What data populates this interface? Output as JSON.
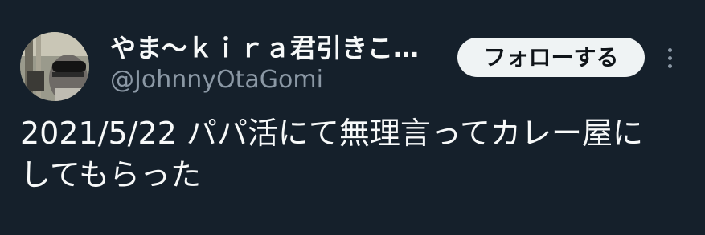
{
  "tweet": {
    "author": {
      "display_name": "やま〜ｋｉｒａ君引きこ…",
      "handle": "@JohnnyOtaGomi"
    },
    "follow_button_label": "フォローする",
    "text_line1": "2021/5/22 パパ活にて無理言ってカレー屋に",
    "text_line2": "してもらった"
  },
  "colors": {
    "background": "#15202b",
    "text_primary": "#f7f9f9",
    "text_secondary": "#8b98a5",
    "follow_button_bg": "#eff3f4"
  },
  "icons": [
    "avatar-image",
    "more-options-icon"
  ]
}
